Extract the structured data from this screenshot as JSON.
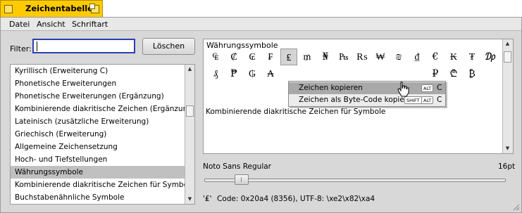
{
  "window": {
    "title": "Zeichentabelle"
  },
  "menubar": {
    "items": [
      "Datei",
      "Ansicht",
      "Schriftart"
    ]
  },
  "filter": {
    "label": "Filter:",
    "value": "",
    "clear_button": "Löschen"
  },
  "blocks": {
    "items": [
      "Kyrillisch (Erweiterung C)",
      "Phonetische Erweiterungen",
      "Phonetische Erweiterungen (Ergänzung)",
      "Kombinierende diakritische Zeichen (Ergänzung)",
      "Lateinisch (zusätzliche Erweiterung)",
      "Griechisch (Erweiterung)",
      "Allgemeine Zeichensetzung",
      "Hoch- und Tiefstellungen",
      "Währungssymbole",
      "Kombinierende diakritische Zeichen für Symbole",
      "Buchstabenähnliche Symbole"
    ],
    "selected_index": 8
  },
  "charmap": {
    "block_title": "Währungssymbole",
    "row1": [
      "₠",
      "₡",
      "₢",
      "₣",
      "₤",
      "₥",
      "₦",
      "₧",
      "₨",
      "₩",
      "₪",
      "₫",
      "€",
      "₭",
      "₮",
      "₯"
    ],
    "row2": [
      "₰",
      "₱",
      "₲",
      "₳",
      "",
      "",
      "",
      "",
      "",
      "",
      "",
      "",
      "₽",
      "₾",
      "₿"
    ],
    "selected_glyph": "₤",
    "next_block_title": "Kombinierende diakritische Zeichen für Symbole"
  },
  "context_menu": {
    "items": [
      {
        "label": "Zeichen kopieren",
        "keys": [
          "ALT"
        ],
        "letter": "C",
        "highlighted": true
      },
      {
        "label": "Zeichen als Byte-Code kopieren",
        "keys": [
          "SHIFT",
          "ALT"
        ],
        "letter": "C",
        "highlighted": false
      }
    ]
  },
  "font": {
    "name": "Noto Sans Regular",
    "size": "16pt",
    "size_fraction": 0.1
  },
  "info": {
    "char": "'₤'",
    "code": "Code: 0x20a4 (8356), UTF-8: \\xe2\\x82\\xa4"
  },
  "colors": {
    "tab": "#ffcb00",
    "focus": "#2a3fb5",
    "selection": "#c0c0c0"
  }
}
